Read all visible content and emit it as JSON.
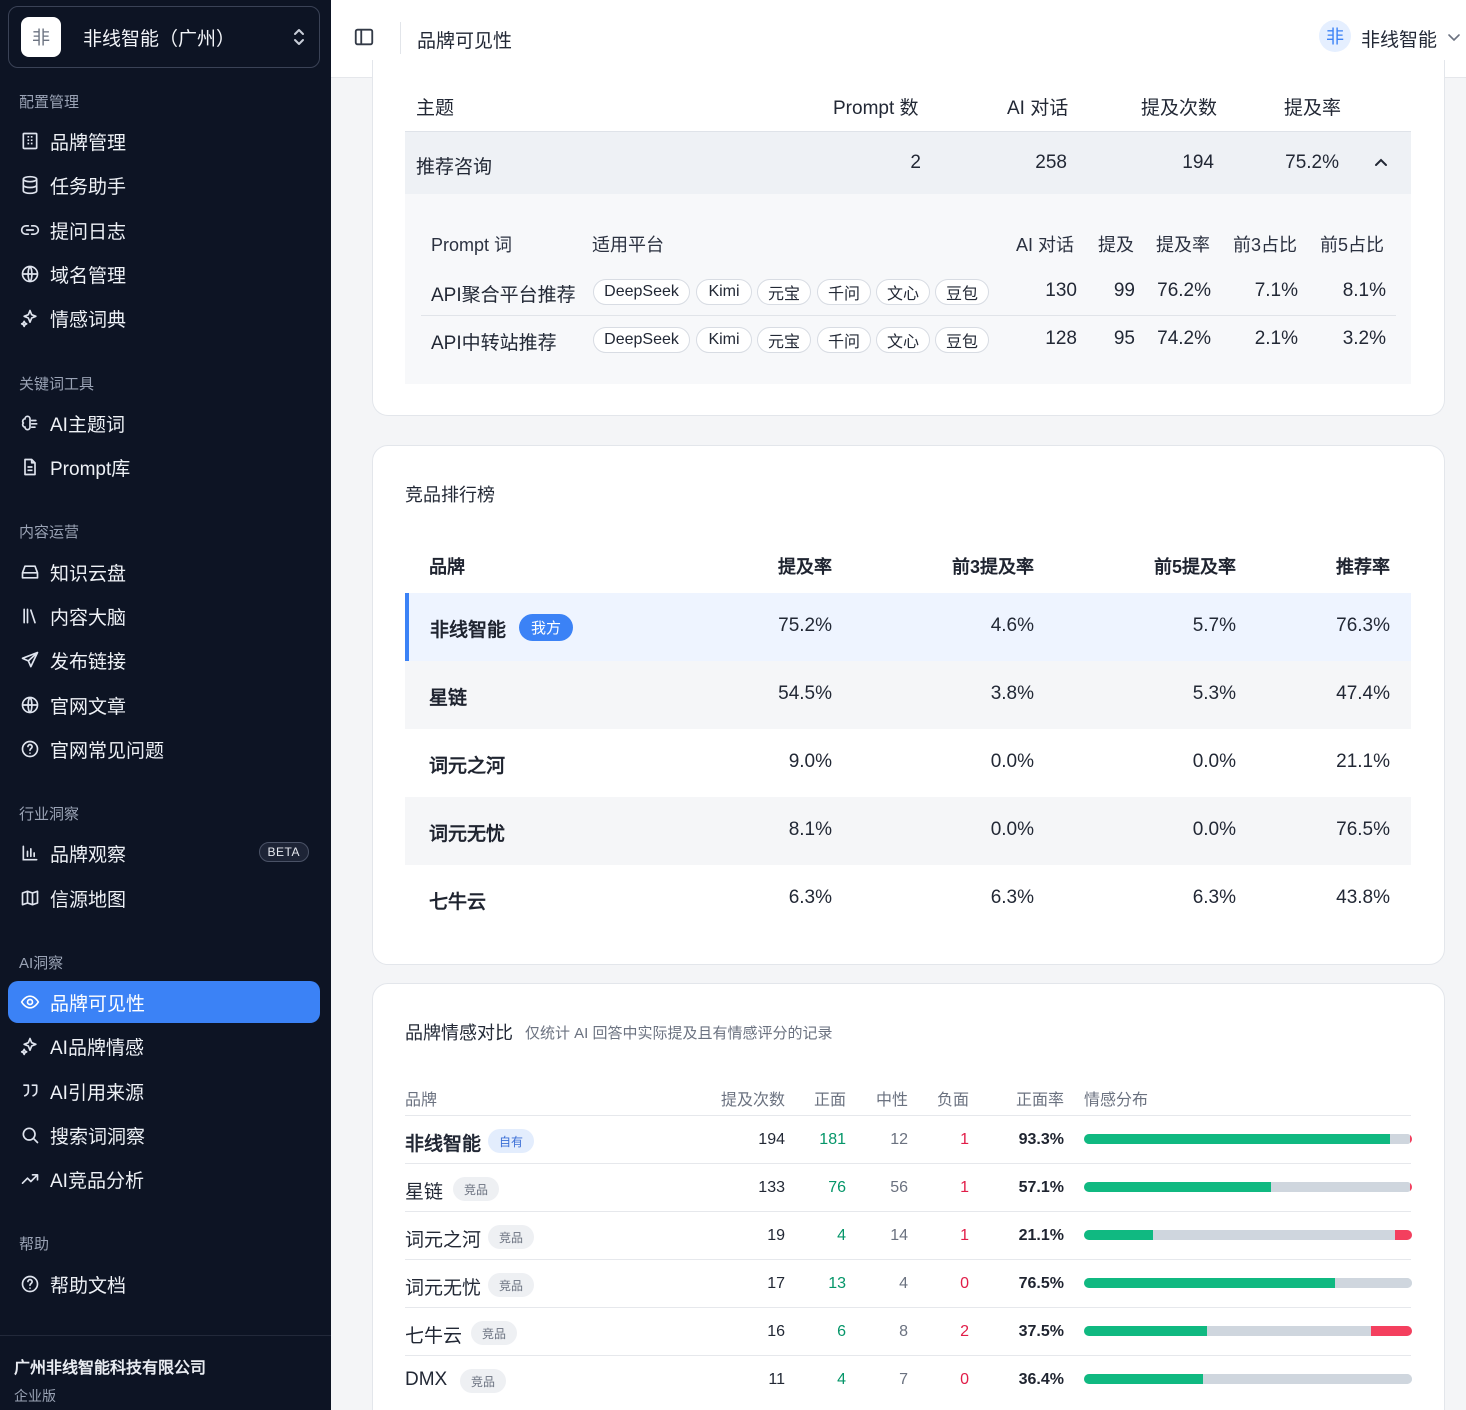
{
  "sidebar": {
    "org": {
      "avatar": "非",
      "name": "非线智能（广州）"
    },
    "sections": {
      "config": "配置管理",
      "keywords": "关键词工具",
      "content": "内容运营",
      "industry": "行业洞察",
      "ai": "AI洞察",
      "help": "帮助"
    },
    "items": {
      "brand_mgmt": "品牌管理",
      "task_assistant": "任务助手",
      "question_log": "提问日志",
      "domain_mgmt": "域名管理",
      "sentiment_dict": "情感词典",
      "ai_topic": "AI主题词",
      "prompt_lib": "Prompt库",
      "knowledge_disk": "知识云盘",
      "content_brain": "内容大脑",
      "publish_link": "发布链接",
      "site_articles": "官网文章",
      "site_faq": "官网常见问题",
      "brand_watch": "品牌观察",
      "source_map": "信源地图",
      "brand_visibility": "品牌可见性",
      "ai_brand_sentiment": "AI品牌情感",
      "ai_citation": "AI引用来源",
      "search_insight": "搜索词洞察",
      "ai_competitor": "AI竞品分析",
      "help_docs": "帮助文档"
    },
    "beta": "BETA",
    "company": "广州非线智能科技有限公司",
    "edition": "企业版"
  },
  "header": {
    "title": "品牌可见性",
    "user_avatar": "非",
    "user_name": "非线智能"
  },
  "topics": {
    "headers": {
      "topic": "主题",
      "prompts": "Prompt 数",
      "dialogs": "AI 对话",
      "mentions": "提及次数",
      "rate": "提及率"
    },
    "row": {
      "topic": "推荐咨询",
      "prompts": "2",
      "dialogs": "258",
      "mentions": "194",
      "rate": "75.2%"
    },
    "sub_headers": {
      "prompt": "Prompt 词",
      "platforms": "适用平台",
      "dialogs": "AI 对话",
      "mentions": "提及",
      "rate": "提及率",
      "top3": "前3占比",
      "top5": "前5占比"
    },
    "platforms": [
      "DeepSeek",
      "Kimi",
      "元宝",
      "千问",
      "文心",
      "豆包"
    ],
    "sub_rows": [
      {
        "prompt": "API聚合平台推荐",
        "dialogs": "130",
        "mentions": "99",
        "rate": "76.2%",
        "top3": "7.1%",
        "top5": "8.1%"
      },
      {
        "prompt": "API中转站推荐",
        "dialogs": "128",
        "mentions": "95",
        "rate": "74.2%",
        "top3": "2.1%",
        "top5": "3.2%"
      }
    ]
  },
  "ranking": {
    "title": "竞品排行榜",
    "headers": {
      "brand": "品牌",
      "rate": "提及率",
      "top3": "前3提及率",
      "top5": "前5提及率",
      "recommend": "推荐率"
    },
    "mine_badge": "我方",
    "rows": [
      {
        "brand": "非线智能",
        "rate": "75.2%",
        "top3": "4.6%",
        "top5": "5.7%",
        "recommend": "76.3%"
      },
      {
        "brand": "星链",
        "rate": "54.5%",
        "top3": "3.8%",
        "top5": "5.3%",
        "recommend": "47.4%"
      },
      {
        "brand": "词元之河",
        "rate": "9.0%",
        "top3": "0.0%",
        "top5": "0.0%",
        "recommend": "21.1%"
      },
      {
        "brand": "词元无忧",
        "rate": "8.1%",
        "top3": "0.0%",
        "top5": "0.0%",
        "recommend": "76.5%"
      },
      {
        "brand": "七牛云",
        "rate": "6.3%",
        "top3": "6.3%",
        "top5": "6.3%",
        "recommend": "43.8%"
      }
    ]
  },
  "sentiment": {
    "title": "品牌情感对比",
    "subtitle": "仅统计 AI 回答中实际提及且有情感评分的记录",
    "headers": {
      "brand": "品牌",
      "mentions": "提及次数",
      "positive": "正面",
      "neutral": "中性",
      "negative": "负面",
      "pos_rate": "正面率",
      "distribution": "情感分布"
    },
    "colors": {
      "positive": "#10b981",
      "neutral": "#cfd6de",
      "negative": "#f43f5e"
    },
    "rows": [
      {
        "brand": "非线智能",
        "tag": "自有",
        "mentions": "194",
        "positive": "181",
        "neutral": "12",
        "negative": "1",
        "pos_rate": "93.3%"
      },
      {
        "brand": "星链",
        "tag": "竞品",
        "mentions": "133",
        "positive": "76",
        "neutral": "56",
        "negative": "1",
        "pos_rate": "57.1%"
      },
      {
        "brand": "词元之河",
        "tag": "竞品",
        "mentions": "19",
        "positive": "4",
        "neutral": "14",
        "negative": "1",
        "pos_rate": "21.1%"
      },
      {
        "brand": "词元无忧",
        "tag": "竞品",
        "mentions": "17",
        "positive": "13",
        "neutral": "4",
        "negative": "0",
        "pos_rate": "76.5%"
      },
      {
        "brand": "七牛云",
        "tag": "竞品",
        "mentions": "16",
        "positive": "6",
        "neutral": "8",
        "negative": "2",
        "pos_rate": "37.5%"
      },
      {
        "brand": "DMX",
        "tag": "竞品",
        "mentions": "11",
        "positive": "4",
        "neutral": "7",
        "negative": "0",
        "pos_rate": "36.4%"
      }
    ]
  }
}
